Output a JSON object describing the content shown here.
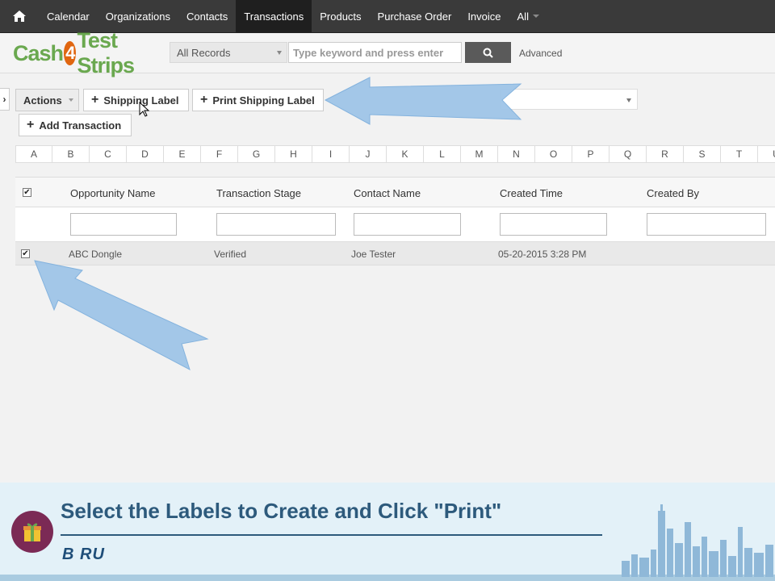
{
  "nav": {
    "items": [
      {
        "label": "Calendar"
      },
      {
        "label": "Organizations"
      },
      {
        "label": "Contacts"
      },
      {
        "label": "Transactions",
        "active": true
      },
      {
        "label": "Products"
      },
      {
        "label": "Purchase Order"
      },
      {
        "label": "Invoice"
      },
      {
        "label": "All"
      }
    ]
  },
  "logo": {
    "part1": "Cash",
    "part2": "4",
    "part3": "Test Strips"
  },
  "search": {
    "records_value": "All Records",
    "placeholder": "Type keyword and press enter",
    "advanced_label": "Advanced"
  },
  "toolbar": {
    "actions_label": "Actions",
    "shipping_label": "Shipping Label",
    "print_shipping_label": "Print Shipping Label",
    "add_transaction_label": "Add Transaction"
  },
  "alphabet": [
    "A",
    "B",
    "C",
    "D",
    "E",
    "F",
    "G",
    "H",
    "I",
    "J",
    "K",
    "L",
    "M",
    "N",
    "O",
    "P",
    "Q",
    "R",
    "S",
    "T",
    "U"
  ],
  "table": {
    "headers": [
      "Opportunity Name",
      "Transaction Stage",
      "Contact Name",
      "Created Time",
      "Created By"
    ],
    "rows": [
      {
        "checked": true,
        "opportunity": "ABC Dongle",
        "stage": "Verified",
        "contact": "Joe Tester",
        "created_time": "05-20-2015 3:28 PM",
        "created_by": ""
      }
    ]
  },
  "banner": {
    "caption": "Select the Labels to Create and Click \"Print\"",
    "brand": "B  RU"
  },
  "colors": {
    "nav_bg": "#3a3a3a",
    "accent_arrow": "#9fc5e8",
    "caption": "#2d5a7c",
    "logo_green": "#6aa84f",
    "logo_orange": "#e06610"
  },
  "icons": [
    "home-icon",
    "search-icon",
    "plus-icon",
    "chevron-right-icon",
    "mouse-cursor-icon",
    "gift-icon",
    "skyline-icon"
  ]
}
